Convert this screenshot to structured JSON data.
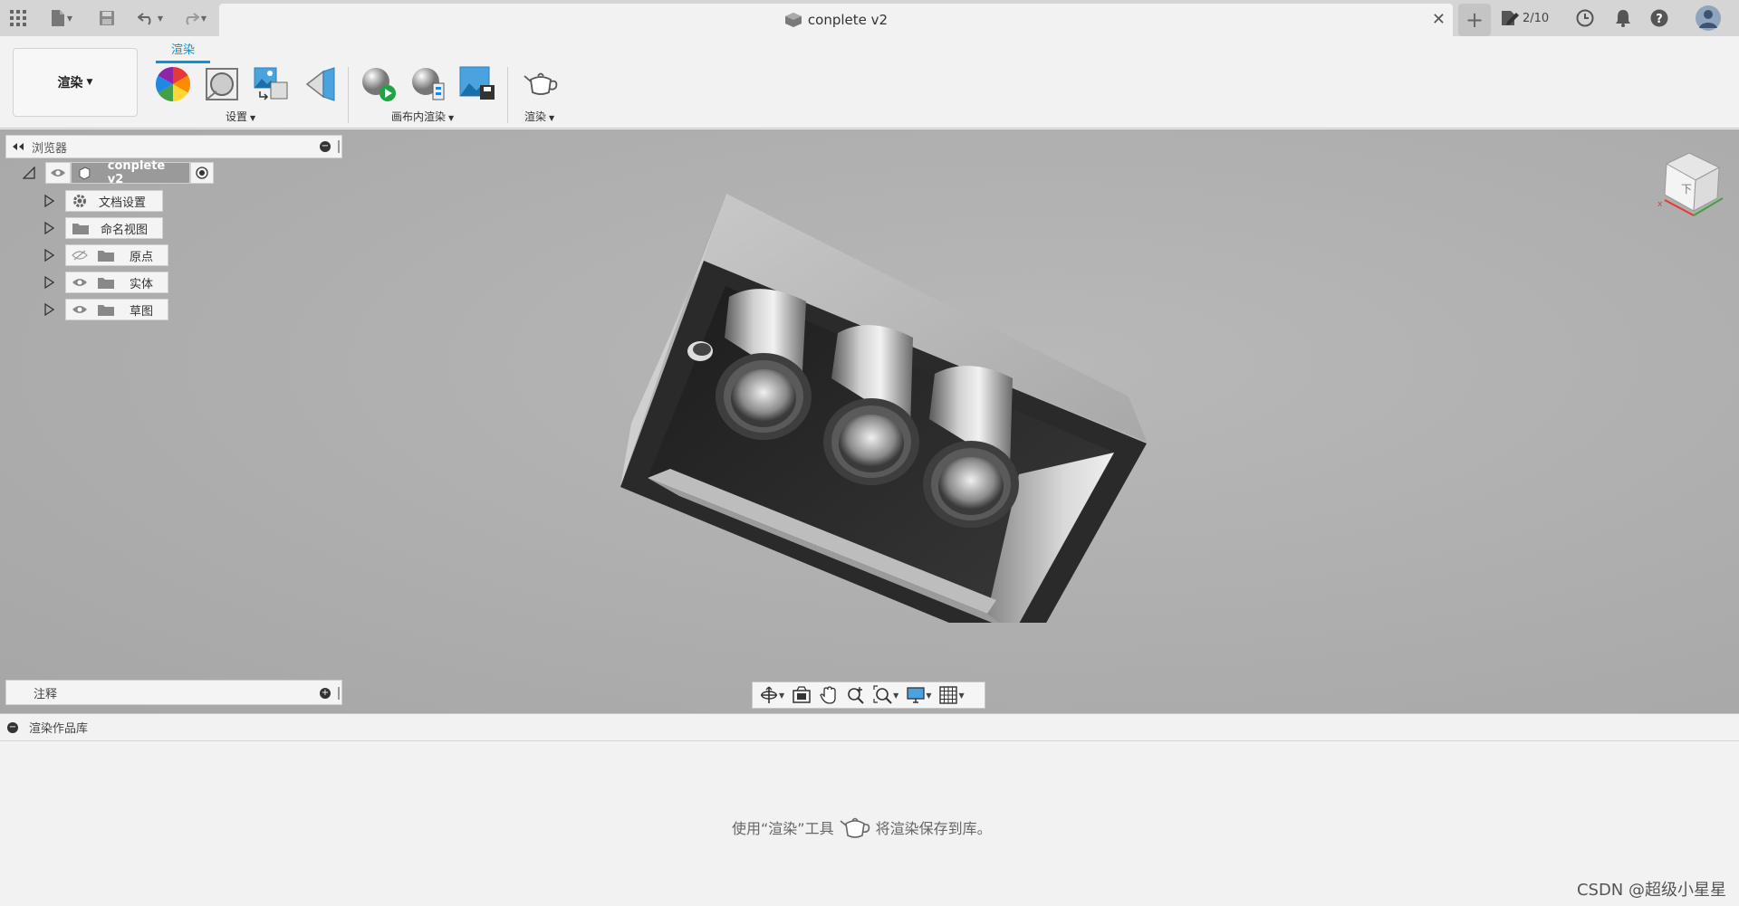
{
  "titlebar": {
    "document_title": "conplete v2",
    "job_status": "2/10"
  },
  "ribbon": {
    "workspace_label": "渲染",
    "active_tab": "渲染",
    "groups": {
      "setup_label": "设置",
      "canvas_render_label": "画布内渲染",
      "render_label": "渲染"
    }
  },
  "browser": {
    "title": "浏览器",
    "root_label": "conplete v2",
    "items": [
      {
        "label": "文档设置"
      },
      {
        "label": "命名视图"
      },
      {
        "label": "原点"
      },
      {
        "label": "实体"
      },
      {
        "label": "草图"
      }
    ]
  },
  "comments": {
    "title": "注释"
  },
  "viewcube": {
    "face_label": "下"
  },
  "gallery": {
    "title": "渲染作品库",
    "message_before": "使用“渲染”工具",
    "message_after": "将渲染保存到库。"
  },
  "watermark": "CSDN @超级小星星",
  "colors": {
    "accent": "#0696d7",
    "canvas": "#adadad"
  }
}
